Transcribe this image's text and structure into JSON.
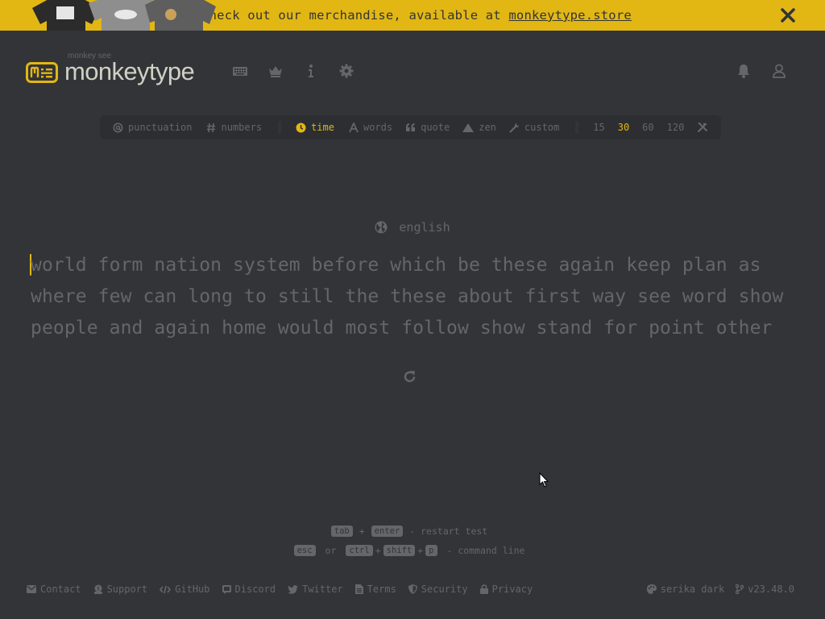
{
  "banner": {
    "text": "Check out our merchandise, available at ",
    "link": "monkeytype.store"
  },
  "header": {
    "logo_sub": "monkey see",
    "logo_title": "monkeytype",
    "nav": [
      "keyboard-icon",
      "crown-icon",
      "info-icon",
      "settings-icon"
    ],
    "account": [
      "bell-icon",
      "user-icon"
    ]
  },
  "config": {
    "punctuation": "punctuation",
    "numbers": "numbers",
    "time": "time",
    "words": "words",
    "quote": "quote",
    "zen": "zen",
    "custom": "custom",
    "durations": [
      "15",
      "30",
      "60",
      "120"
    ],
    "active_mode": "time",
    "active_duration": "30"
  },
  "test": {
    "language": "english",
    "lines": [
      "world form nation system before which be these again keep plan as",
      "where few can long to still the these about first way see word show",
      "people and again home would most follow show stand for point other"
    ]
  },
  "hints": {
    "restart": {
      "key1": "tab",
      "plus": "+",
      "key2": "enter",
      "text": "- restart test"
    },
    "command": {
      "key1": "esc",
      "or": "or",
      "key2": "ctrl",
      "plus1": "+",
      "key3": "shift",
      "plus2": "+",
      "key4": "p",
      "text": "- command line"
    }
  },
  "footer": {
    "links": [
      "Contact",
      "Support",
      "GitHub",
      "Discord",
      "Twitter",
      "Terms",
      "Security",
      "Privacy"
    ],
    "theme": "serika dark",
    "version": "v23.48.0"
  },
  "colors": {
    "bg": "#323437",
    "sub_alt": "#2c2e31",
    "main": "#e2b714",
    "sub": "#646669",
    "text": "#d1d0c5"
  }
}
